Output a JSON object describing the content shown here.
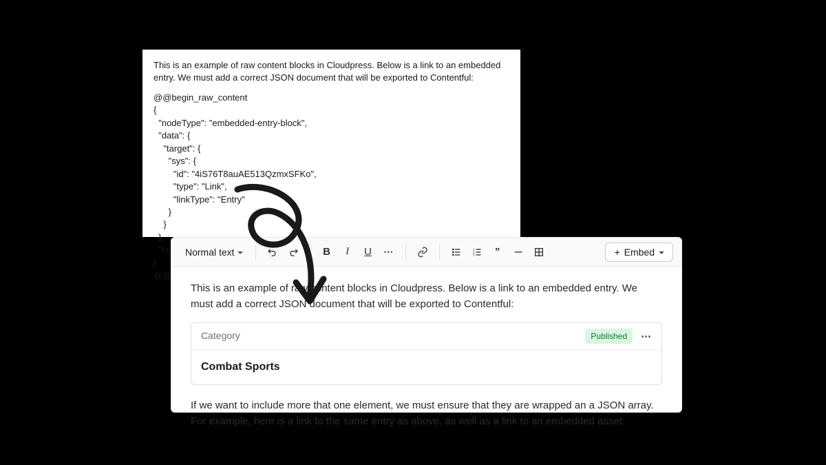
{
  "raw_panel": {
    "intro": "This is an example of raw content blocks in Cloudpress. Below is a link to an embedded entry. We must add a correct JSON document that will be exported to Contentful:",
    "code": "@@begin_raw_content\n{\n  \"nodeType\": \"embedded-entry-block\",\n  \"data\": {\n    \"target\": {\n      \"sys\": {\n        \"id\": \"4iS76T8auAE513QzmxSFKo\",\n        \"type\": \"Link\",\n        \"linkType\": \"Entry\"\n      }\n    }\n  },\n  \"content\": []\n}\n@@end_raw_content"
  },
  "toolbar": {
    "text_style": "Normal text",
    "embed_label": "Embed"
  },
  "editor": {
    "para1": "This is an example of raw content blocks in Cloudpress. Below is a link to an embedded entry. We must add a correct JSON document that will be exported to Contentful:",
    "card": {
      "category": "Category",
      "status": "Published",
      "title": "Combat Sports"
    },
    "para2": "If we want to include more that one element, we must ensure that they are wrapped an a JSON array. For example, here is a link to the same entry as above, as well as a link to an embedded asset:"
  }
}
